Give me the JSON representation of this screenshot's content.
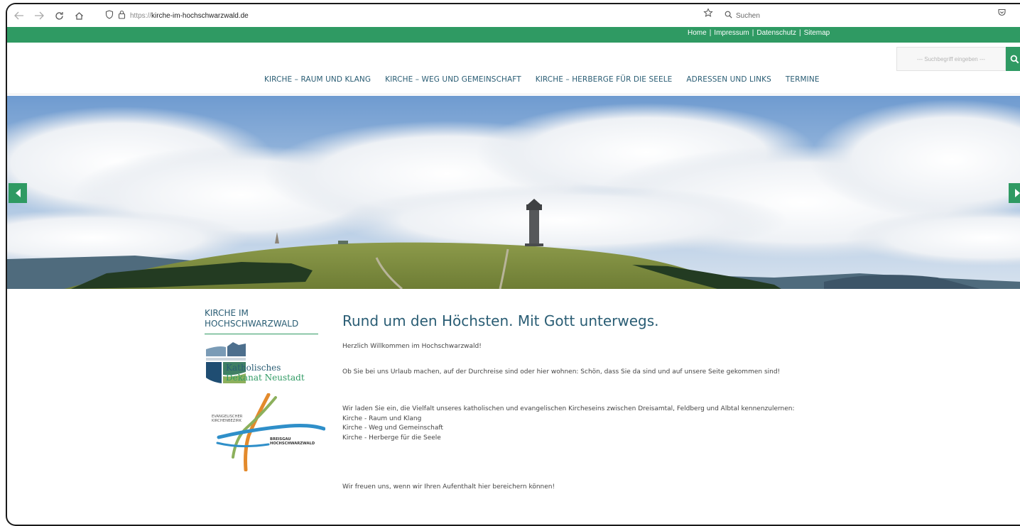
{
  "browser": {
    "url_prefix": "https://",
    "url_domain": "kirche-im-hochschwarzwald.de",
    "search_placeholder": "Suchen",
    "icons": [
      "back-icon",
      "forward-icon",
      "reload-icon",
      "home-icon",
      "shield-icon",
      "lock-icon",
      "star-icon",
      "search-icon",
      "pocket-icon"
    ]
  },
  "topbar": {
    "links": [
      "Home",
      "Impressum",
      "Datenschutz",
      "Sitemap"
    ],
    "color": "#2f9a63"
  },
  "site_search": {
    "placeholder": "--- Suchbegriff eingeben ---"
  },
  "mainnav": {
    "items": [
      "KIRCHE – RAUM UND KLANG",
      "KIRCHE – WEG UND GEMEINSCHAFT",
      "KIRCHE – HERBERGE FÜR DIE SEELE",
      "ADRESSEN UND LINKS",
      "TERMINE"
    ],
    "color": "#2a5d74"
  },
  "sidebar": {
    "title_line1": "KIRCHE IM",
    "title_line2": "HOCHSCHWARZWALD",
    "logo_kath_line1": "Katholisches",
    "logo_kath_line2": "Dekanat Neustadt",
    "logo_evang_line1": "EVANGELISCHER",
    "logo_evang_line2": "KIRCHENBEZIRK",
    "logo_evang_line3": "BREISGAU",
    "logo_evang_line4": "HOCHSCHWARZWALD"
  },
  "content": {
    "title": "Rund um den Höchsten. Mit Gott unterwegs.",
    "welcome": "Herzlich Willkommen im Hochschwarzwald!",
    "para1": "Ob Sie bei uns Urlaub machen, auf der Durchreise sind oder hier wohnen: Schön, dass Sie da sind und auf unsere Seite gekommen sind!",
    "para2": "Wir laden Sie ein, die Vielfalt unseres katholischen und evangelischen Kircheseins zwischen Dreisamtal, Feldberg und Albtal kennenzulernen:",
    "list": [
      "Kirche - Raum und Klang",
      "Kirche - Weg und Gemeinschaft",
      "Kirche - Herberge für die Seele"
    ],
    "closing": "Wir freuen uns, wenn wir Ihren Aufenthalt hier bereichern können!"
  }
}
